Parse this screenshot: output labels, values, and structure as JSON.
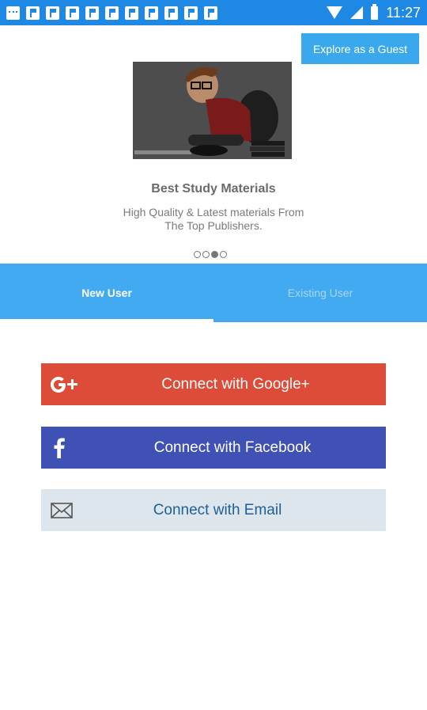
{
  "status_bar": {
    "time": "11:27"
  },
  "carousel": {
    "guest_button": "Explore as a Guest",
    "slide_title": "Best Study Materials",
    "slide_desc_line1": "High Quality & Latest materials From",
    "slide_desc_line2": "The Top Publishers.",
    "dots": 4,
    "active_dot": 3
  },
  "tabs": {
    "new_user": "New User",
    "existing_user": "Existing User"
  },
  "buttons": {
    "google": "Connect with Google+",
    "facebook": "Connect with Facebook",
    "email": "Connect with Email"
  },
  "colors": {
    "status_bar": "#1e88e5",
    "tabs": "#42aaf0",
    "google": "#dd4b39",
    "facebook": "#3f51b5",
    "email": "#dce6ec"
  }
}
